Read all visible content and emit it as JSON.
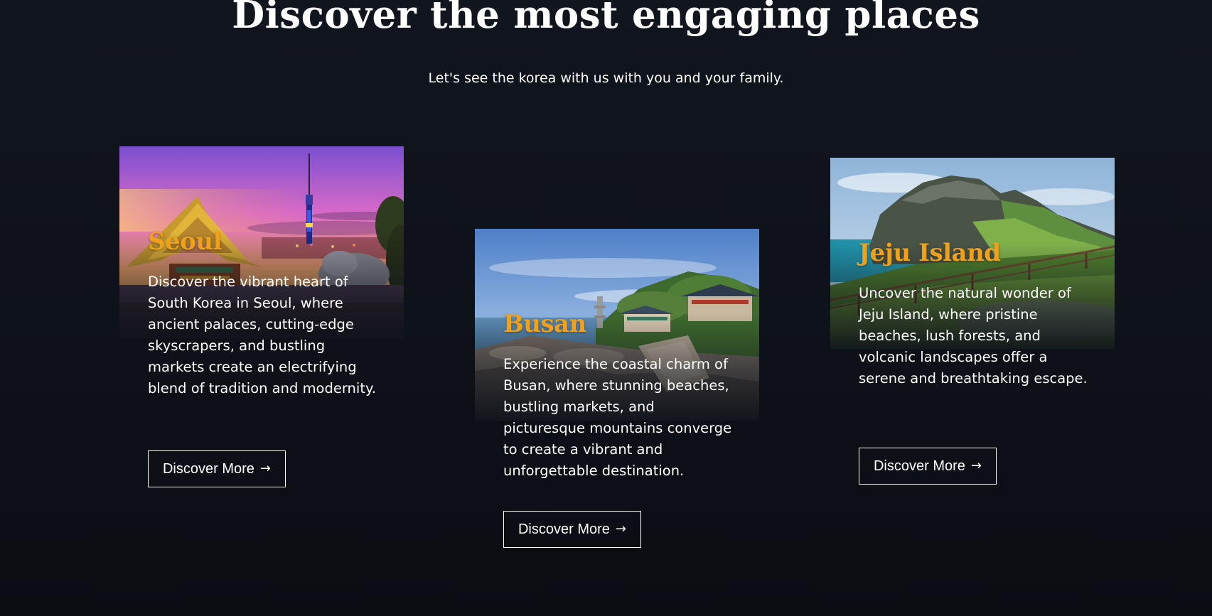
{
  "header": {
    "title": "Discover the most engaging places",
    "subtitle": "Let's see the korea with us with you and your family."
  },
  "cards": [
    {
      "title": "Seoul",
      "description": "Discover the vibrant heart of South Korea in Seoul, where ancient palaces, cutting-edge skyscrapers, and bustling markets create an electrifying blend of tradition and modernity.",
      "button_label": "Discover More",
      "button_icon": "arrow-right-icon",
      "image": "seoul-palace-and-tower-photo"
    },
    {
      "title": "Busan",
      "description": "Experience the coastal charm of Busan, where stunning beaches, bustling markets, and picturesque mountains converge to create a vibrant and unforgettable destination.",
      "button_label": "Discover More",
      "button_icon": "arrow-right-icon",
      "image": "busan-coastal-temple-photo"
    },
    {
      "title": "Jeju Island",
      "description": "Uncover the natural wonder of Jeju Island, where pristine beaches, lush forests, and volcanic landscapes offer a serene and breathtaking escape.",
      "button_label": "Discover More",
      "button_icon": "arrow-right-icon",
      "image": "jeju-volcanic-crater-photo"
    }
  ],
  "colors": {
    "background": "#0f121a",
    "accent": "#f0a11b",
    "text": "#ffffff"
  }
}
